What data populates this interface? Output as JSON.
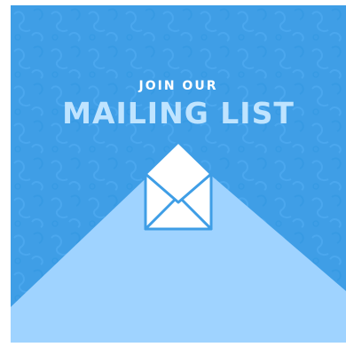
{
  "banner": {
    "eyebrow": "JOIN OUR",
    "headline": "MAILING LIST",
    "icon": "envelope-open-icon"
  },
  "colors": {
    "background": "#3f9ee6",
    "triangle": "#9fd3ff",
    "headline": "#bfe4ff",
    "eyebrow": "#ffffff",
    "icon_stroke": "#3f9ee6"
  }
}
